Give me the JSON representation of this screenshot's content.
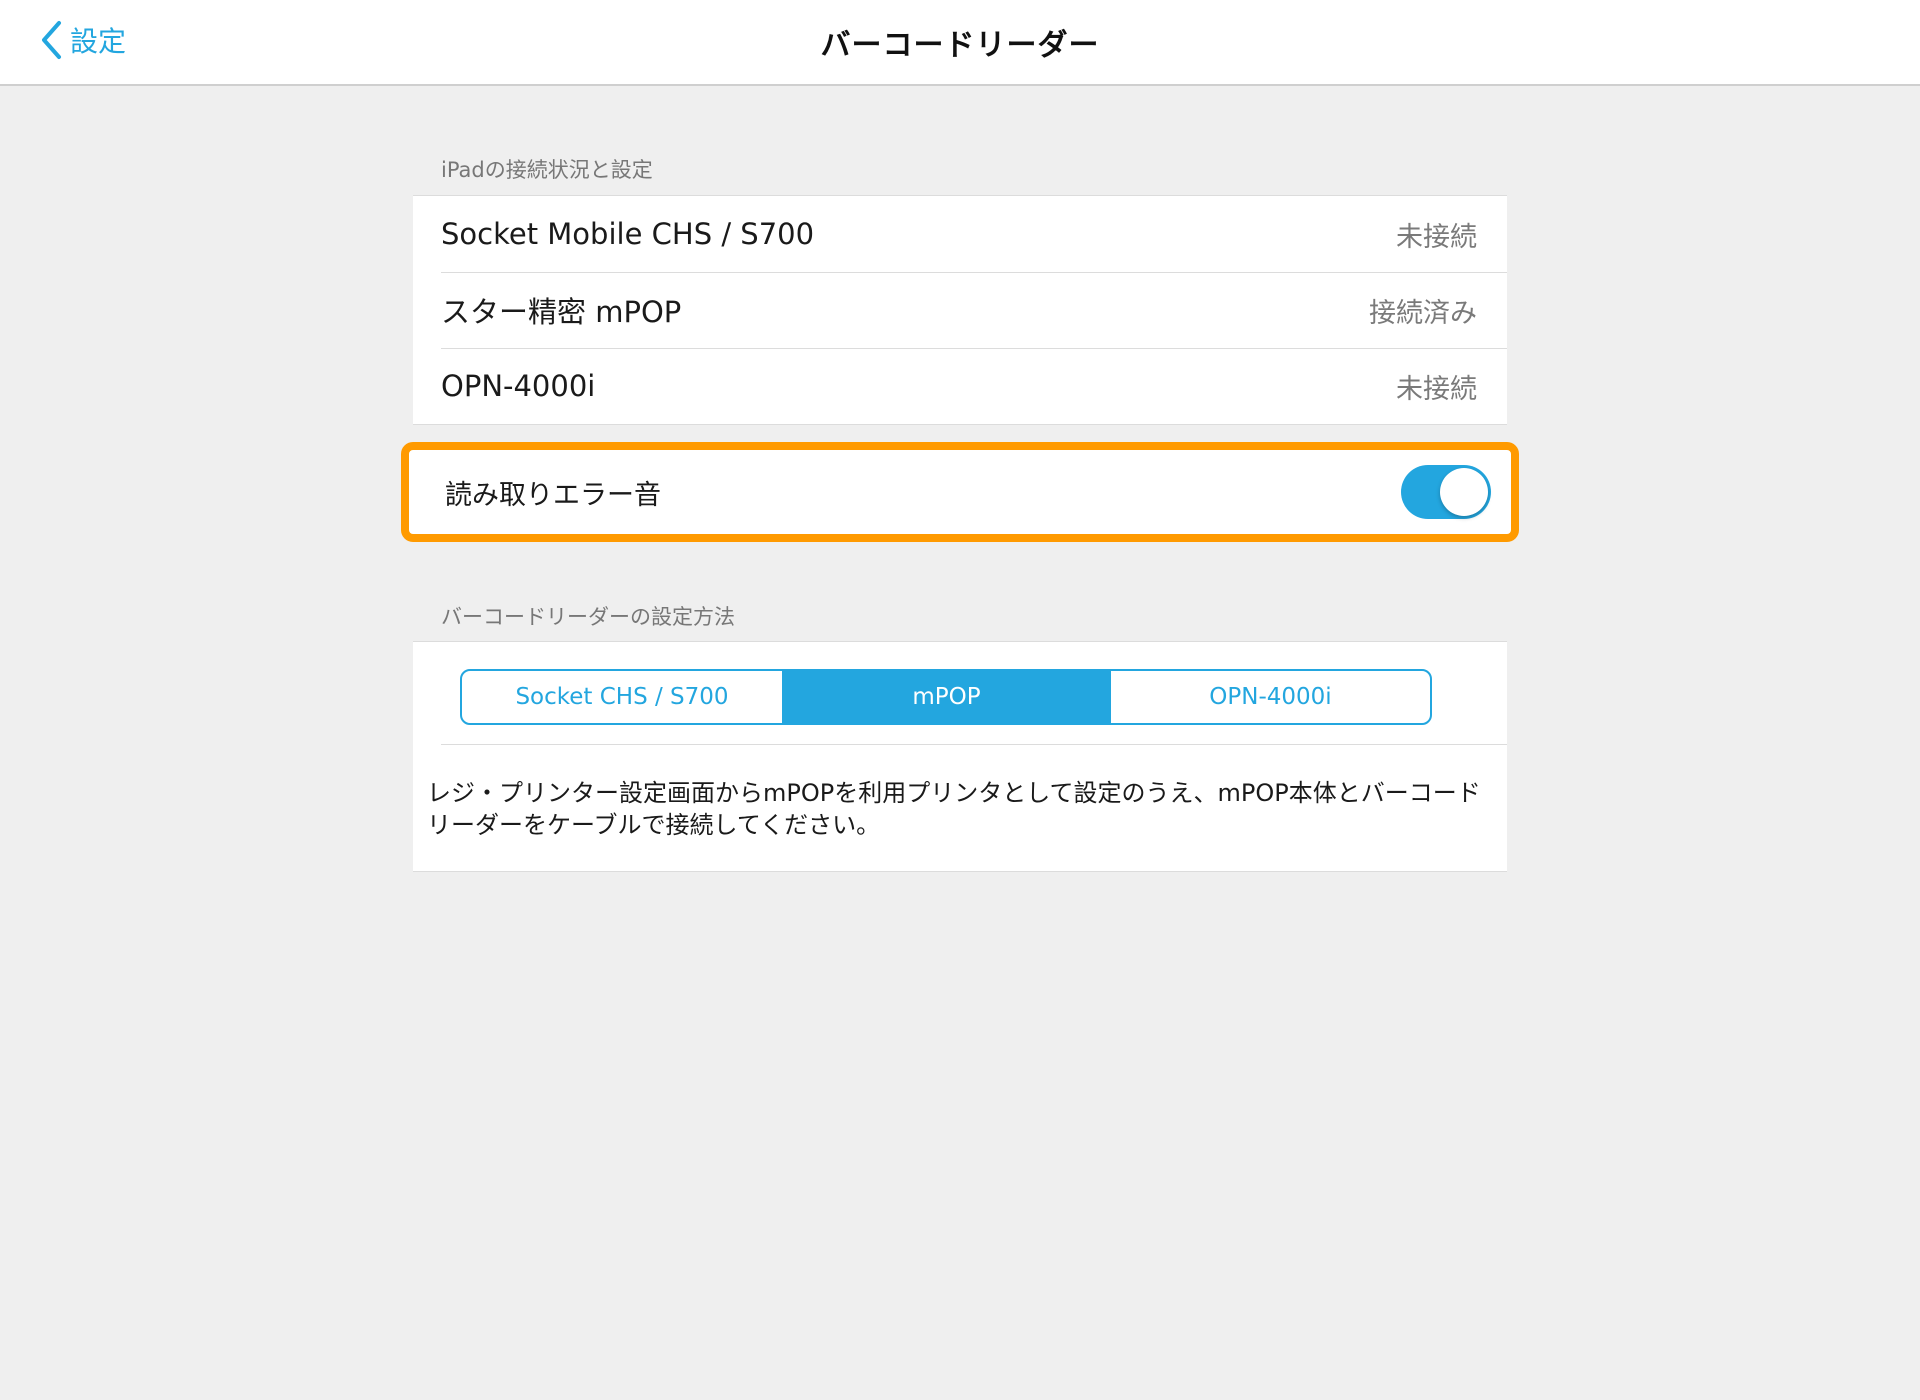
{
  "nav": {
    "back_label": "設定",
    "title": "バーコードリーダー"
  },
  "connection_section": {
    "header": "iPadの接続状況と設定",
    "devices": [
      {
        "name": "Socket Mobile CHS / S700",
        "status": "未接続"
      },
      {
        "name": "スター精密 mPOP",
        "status": "接続済み"
      },
      {
        "name": "OPN-4000i",
        "status": "未接続"
      }
    ]
  },
  "error_sound": {
    "label": "読み取りエラー音",
    "enabled": true
  },
  "setup_section": {
    "header": "バーコードリーダーの設定方法",
    "segments": [
      "Socket CHS / S700",
      "mPOP",
      "OPN-4000i"
    ],
    "selected_segment": "mPOP",
    "description": "レジ・プリンター設定画面からmPOPを利用プリンタとして設定のうえ、mPOP本体とバーコードリーダーをケーブルで接続してください。"
  },
  "colors": {
    "accent": "#23a6df",
    "highlight": "#ff9a00",
    "background": "#efefef"
  }
}
